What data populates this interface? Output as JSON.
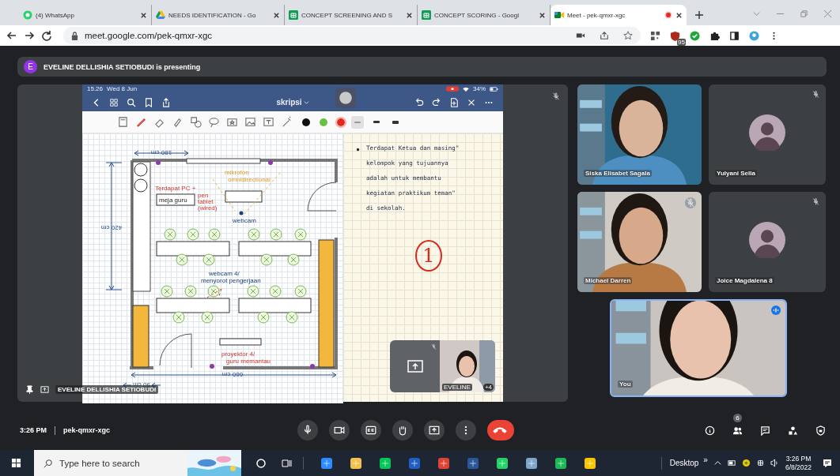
{
  "browser": {
    "tabs": [
      {
        "title": "(4) WhatsApp",
        "kind": "whatsapp",
        "selected": false,
        "recording": false
      },
      {
        "title": "NEEDS IDENTIFICATION - Go",
        "kind": "drive",
        "selected": false,
        "recording": false
      },
      {
        "title": "CONCEPT SCREENING AND S",
        "kind": "sheets",
        "selected": false,
        "recording": false
      },
      {
        "title": "CONCEPT SCORING - Googl",
        "kind": "sheets",
        "selected": false,
        "recording": false
      },
      {
        "title": "Meet - pek-qmxr-xgc",
        "kind": "meet",
        "selected": true,
        "recording": true
      }
    ],
    "url": "meet.google.com/pek-qmxr-xgc",
    "extension_badge": "95"
  },
  "presenting_banner": {
    "initial": "E",
    "text": "EVELINE DELLISHIA SETIOBUDI is presenting"
  },
  "presentation": {
    "muted": true,
    "presenter": "EVELINE DELLISHIA SETIOBUDI",
    "tablet": {
      "time": "15.26",
      "date": "Wed 8 Jun",
      "battery": "34%",
      "doc_title": "skripsi",
      "pen_colors": [
        {
          "color": "#111111",
          "selected": false
        },
        {
          "color": "#6abf45",
          "selected": false
        },
        {
          "color": "#e0281c",
          "selected": true
        }
      ],
      "stroke_widths": [
        {
          "selected": true
        },
        {
          "selected": false
        },
        {
          "selected": false
        }
      ],
      "floor_plan": {
        "width_top": "180 cm",
        "height_left": "420 cm",
        "width_bottom": "660 cm",
        "door_width": "90 cm",
        "teacher_pc": "Terdapat PC +",
        "teacher_desk": "meja guru",
        "pen_tablet": [
          "pen",
          "tablet",
          "(wired)"
        ],
        "microphone": [
          "mikrofon",
          "omnidirectional"
        ],
        "webcam": "webcam",
        "desk_webcam": [
          "webcam 4/",
          "menyorot pengerjaan"
        ],
        "projector": [
          "proyektor 4/",
          "guru memantau"
        ]
      },
      "notes": [
        "Terdapat Ketua dan masing\"",
        "kelompok yang tujuannya",
        "adalah untuk membantu",
        "kegiatan praktikum teman\"",
        "di sekolah."
      ],
      "page_mark": "1"
    },
    "self_preview": {
      "name": "EVELINE",
      "more": "+4",
      "muted": true
    }
  },
  "participants": [
    {
      "name": "Siska Elisabet Sagala",
      "kind": "video",
      "muted": false,
      "speaking": false
    },
    {
      "name": "Yulyani Sella",
      "kind": "avatar",
      "muted": true,
      "speaking": false
    },
    {
      "name": "Michael Darren",
      "kind": "video",
      "muted": true,
      "speaking": false
    },
    {
      "name": "Joice Magdalena 8",
      "kind": "avatar",
      "muted": true,
      "speaking": false
    },
    {
      "name": "You",
      "kind": "video",
      "muted": false,
      "speaking": true
    }
  ],
  "call_bar": {
    "time": "3:26 PM",
    "meeting_code": "pek-qmxr-xgc",
    "people_count": "6"
  },
  "taskbar": {
    "search_placeholder": "Type here to search",
    "desktop_label": "Desktop",
    "overflow": "»",
    "time": "3:26 PM",
    "date": "6/8/2022"
  }
}
